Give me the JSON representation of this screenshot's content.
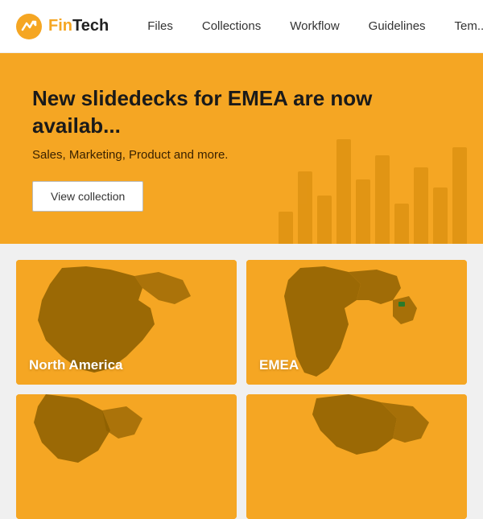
{
  "header": {
    "logo_name": "FinTech",
    "logo_name_start": "Fin",
    "logo_name_end": "Tech",
    "nav_items": [
      {
        "label": "Files"
      },
      {
        "label": "Collections"
      },
      {
        "label": "Workflow"
      },
      {
        "label": "Guidelines"
      },
      {
        "label": "Tem..."
      }
    ]
  },
  "hero": {
    "heading": "New slidedecks for EMEA are now availab...",
    "subheading": "Sales, Marketing, Product and more.",
    "cta_label": "View collection",
    "bars": [
      40,
      90,
      60,
      130,
      80,
      110,
      50,
      95,
      70,
      120
    ]
  },
  "cards": [
    {
      "label": "North America",
      "region": "north_america"
    },
    {
      "label": "EMEA",
      "region": "emea"
    },
    {
      "label": "",
      "region": "bottom_left"
    },
    {
      "label": "",
      "region": "bottom_right"
    }
  ]
}
